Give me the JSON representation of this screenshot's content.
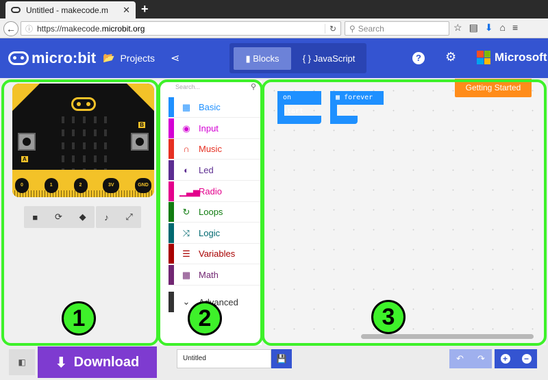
{
  "browser": {
    "tab_title": "Untitled - makecode.m",
    "tab_close": "✕",
    "new_tab": "+",
    "url_prefix": "https://makecode.",
    "url_domain": "microbit.org",
    "search_placeholder": "Search"
  },
  "header": {
    "logo_text": "micro:bit",
    "projects_label": "Projects",
    "mode_blocks": "Blocks",
    "mode_javascript": "JavaScript",
    "mode_blocks_icon": "puzzle-icon",
    "mode_js_icon": "braces-icon",
    "help_label": "?",
    "brand": "Microsoft"
  },
  "simulator": {
    "label_a": "A",
    "label_b": "B",
    "pins": [
      "0",
      "1",
      "2",
      "3V",
      "GND"
    ]
  },
  "toolbox": {
    "search_placeholder": "Search...",
    "categories": [
      {
        "label": "Basic",
        "color": "#1e90ff",
        "icon": "grid-icon"
      },
      {
        "label": "Input",
        "color": "#d400d4",
        "icon": "target-icon"
      },
      {
        "label": "Music",
        "color": "#e63022",
        "icon": "headphones-icon"
      },
      {
        "label": "Led",
        "color": "#5c2d91",
        "icon": "toggle-icon"
      },
      {
        "label": "Radio",
        "color": "#e3008c",
        "icon": "signal-icon"
      },
      {
        "label": "Loops",
        "color": "#107c10",
        "icon": "refresh-icon"
      },
      {
        "label": "Logic",
        "color": "#006970",
        "icon": "shuffle-icon"
      },
      {
        "label": "Variables",
        "color": "#a80000",
        "icon": "lines-icon"
      },
      {
        "label": "Math",
        "color": "#712672",
        "icon": "calculator-icon"
      }
    ],
    "advanced_label": "Advanced"
  },
  "workspace": {
    "getting_started": "Getting Started",
    "block_on_start": "on start",
    "block_forever": "forever"
  },
  "badges": [
    "1",
    "2",
    "3"
  ],
  "footer": {
    "download_label": "Download",
    "project_name": "Untitled"
  },
  "colors": {
    "header_blue": "#3454d1",
    "highlight_green": "#3ef12a",
    "download_purple": "#7e3bd0",
    "getting_started_orange": "#ff8c1a",
    "board_yellow": "#f3c228"
  }
}
